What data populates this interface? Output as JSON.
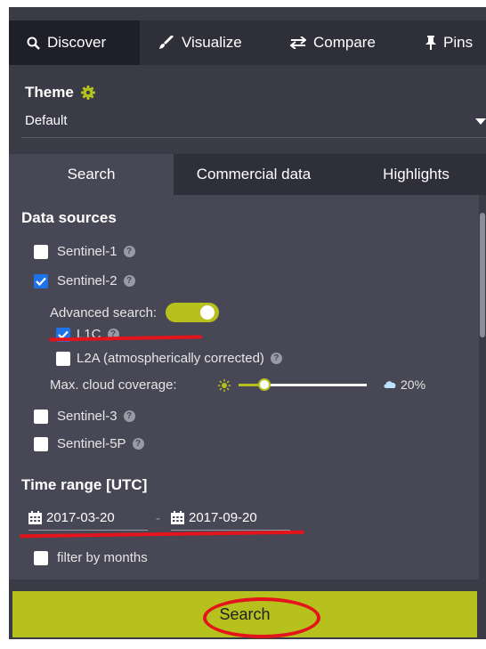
{
  "top_tabs": [
    {
      "label": "Discover",
      "icon": "search-icon"
    },
    {
      "label": "Visualize",
      "icon": "brush-icon"
    },
    {
      "label": "Compare",
      "icon": "swap-icon"
    },
    {
      "label": "Pins",
      "icon": "pin-icon"
    }
  ],
  "theme": {
    "label": "Theme",
    "value": "Default"
  },
  "sub_tabs": [
    "Search",
    "Commercial data",
    "Highlights"
  ],
  "data_sources": {
    "title": "Data sources",
    "sentinel1": {
      "label": "Sentinel-1",
      "checked": false
    },
    "sentinel2": {
      "label": "Sentinel-2",
      "checked": true
    },
    "advanced_search": {
      "label": "Advanced search:",
      "enabled": true
    },
    "l1c": {
      "label": "L1C",
      "checked": true
    },
    "l2a": {
      "label": "L2A (atmospherically corrected)",
      "checked": false
    },
    "cloud": {
      "label": "Max. cloud coverage:",
      "value_text": "20%",
      "value": 0.2
    },
    "sentinel3": {
      "label": "Sentinel-3",
      "checked": false
    },
    "sentinel5p": {
      "label": "Sentinel-5P",
      "checked": false
    }
  },
  "time_range": {
    "title": "Time range [UTC]",
    "from": "2017-03-20",
    "separator": "-",
    "to": "2017-09-20",
    "filter_label": "filter by months"
  },
  "search_button": "Search",
  "colors": {
    "accent": "#b6c11d",
    "checkbox": "#1e73e8",
    "annotation": "#e3141c"
  }
}
